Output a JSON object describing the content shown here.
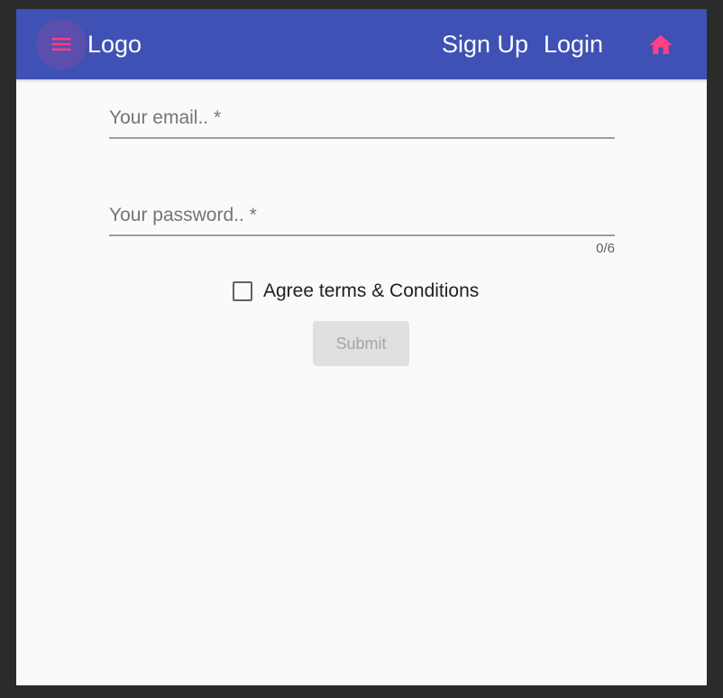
{
  "toolbar": {
    "menu_icon": "menu-icon",
    "logo": "Logo",
    "nav": [
      {
        "label": "Sign Up"
      },
      {
        "label": "Login"
      }
    ],
    "home_icon": "home-icon",
    "colors": {
      "background": "#3f51b5",
      "accent": "#ff4081"
    }
  },
  "form": {
    "email": {
      "placeholder": "Your email.. *",
      "value": ""
    },
    "password": {
      "placeholder": "Your password.. *",
      "value": "",
      "counter": "0/6"
    },
    "terms": {
      "label": "Agree terms & Conditions",
      "checked": false
    },
    "submit_label": "Submit"
  }
}
